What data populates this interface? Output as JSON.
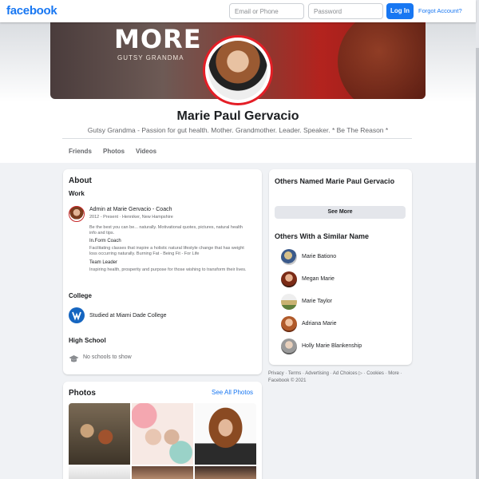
{
  "nav": {
    "logo": "facebook",
    "email_placeholder": "Email or Phone",
    "password_placeholder": "Password",
    "login_label": "Log In",
    "forgot_label": "Forgot Account?"
  },
  "profile": {
    "cover_title": "MORE",
    "cover_subtitle": "GUTSY GRANDMA",
    "name": "Marie Paul Gervacio",
    "bio": "Gutsy Grandma - Passion for gut health. Mother. Grandmother. Leader. Speaker. * Be The Reason *",
    "tabs": [
      "Friends",
      "Photos",
      "Videos"
    ]
  },
  "about": {
    "title": "About",
    "work_title": "Work",
    "job_title": "Admin at Marie Gervacio - Coach",
    "job_meta": "2012 - Present · Henniker, New Hampshire",
    "job_desc": "Be the best you can be... naturally. Motivational quotes, pictures, natural health info and tips.",
    "role1_title": "In.Form Coach",
    "role1_desc": "Facilitating classes that inspire a holistic natural lifestyle change that has weight loss occurring naturally. Burning Fat - Being Fit - For Life",
    "role2_title": "Team Leader",
    "role2_desc": "Inspiring health, prosperity and purpose for those wishing to transform their lives.",
    "college_title": "College",
    "college_text": "Studied at Miami Dade College",
    "highschool_title": "High School",
    "highschool_text": "No schools to show"
  },
  "others": {
    "named_title": "Others Named Marie Paul Gervacio",
    "see_more_label": "See More",
    "similar_title": "Others With a Similar Name",
    "people": [
      "Marie Bationo",
      "Megan Marie",
      "Marie Taylor",
      "Adriana Marie",
      "Holly Marie Blankenship"
    ]
  },
  "footer": {
    "links": "Privacy · Terms · Advertising · Ad Choices ▷ · Cookies · More · Facebook © 2021"
  },
  "photos": {
    "title": "Photos",
    "see_all_label": "See All Photos"
  },
  "colors": {
    "brand": "#1877f2",
    "page_bg": "#f0f2f5"
  }
}
